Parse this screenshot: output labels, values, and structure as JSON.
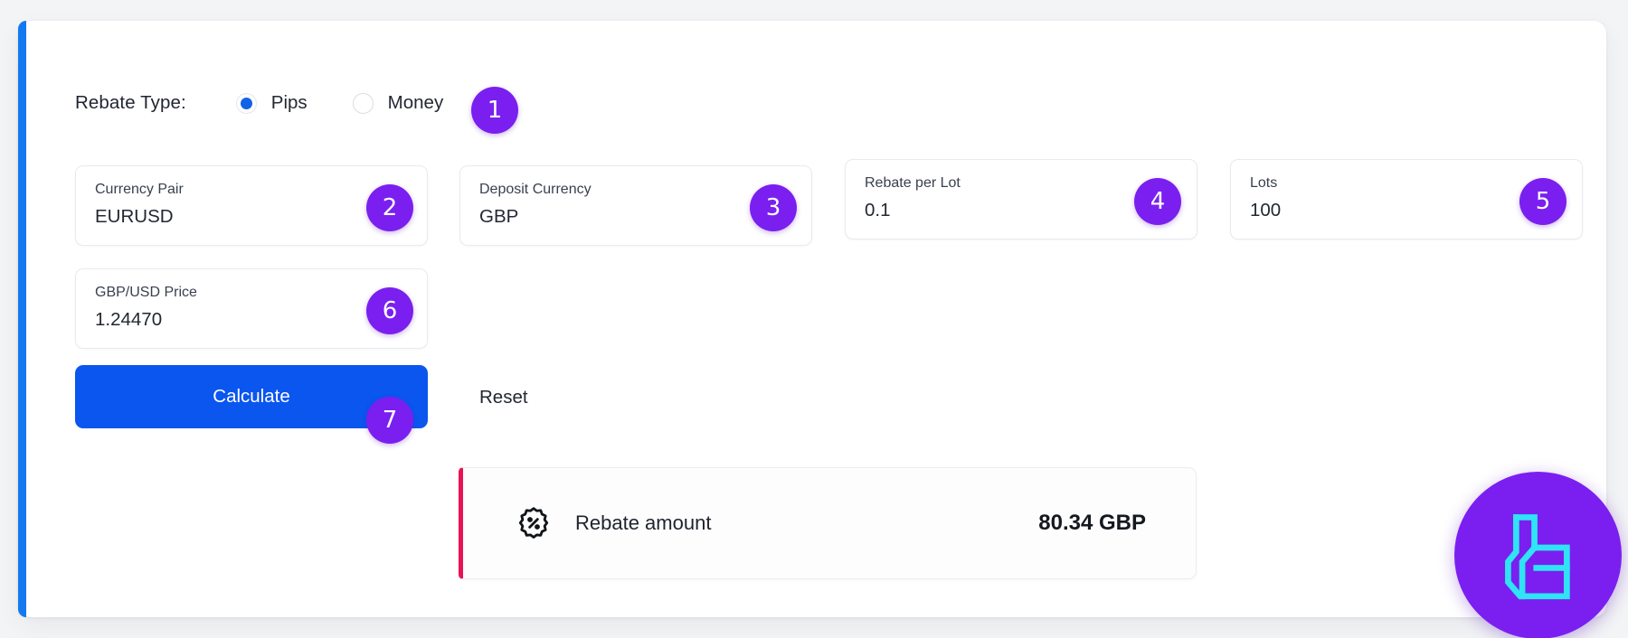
{
  "form": {
    "rebate_type": {
      "label": "Rebate Type:",
      "options": [
        {
          "label": "Pips",
          "selected": true
        },
        {
          "label": "Money",
          "selected": false
        }
      ]
    },
    "fields": [
      {
        "label": "Currency Pair",
        "value": "EURUSD"
      },
      {
        "label": "Deposit Currency",
        "value": "GBP"
      },
      {
        "label": "Rebate per Lot",
        "value": "0.1"
      },
      {
        "label": "Lots",
        "value": "100"
      },
      {
        "label": "GBP/USD Price",
        "value": "1.24470"
      }
    ],
    "actions": {
      "calculate_label": "Calculate",
      "reset_label": "Reset"
    }
  },
  "result": {
    "icon": "percent-seal-icon",
    "label": "Rebate amount",
    "value": "80.34 GBP"
  },
  "badges": [
    "1",
    "2",
    "3",
    "4",
    "5",
    "6",
    "7"
  ],
  "logo": {
    "name": "brand-logo",
    "letter": "L"
  },
  "colors": {
    "accent_blue": "#1479f0",
    "button_blue": "#0a56ef",
    "badge_purple": "#7a1ff0",
    "result_border": "#ea1256",
    "logo_mark": "#2fe4f5"
  }
}
